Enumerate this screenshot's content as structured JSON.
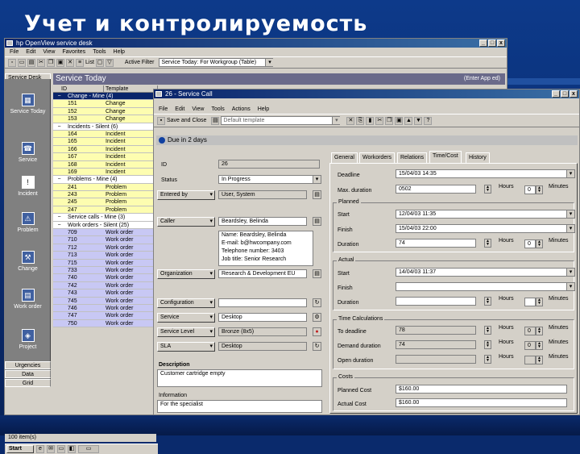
{
  "slide": {
    "title": "Учет и контролируемость"
  },
  "main_window": {
    "title": "hp OpenView service desk",
    "menu": [
      "File",
      "Edit",
      "View",
      "Favorites",
      "Tools",
      "Help"
    ],
    "toolbar": {
      "filter_label": "Active Filter",
      "view_label": "List",
      "view_value": "Service Today: For Workgroup (Table)"
    },
    "sidebar": {
      "header": "Service Desk",
      "items": [
        "Service Today",
        "Service",
        "Incident",
        "Problem",
        "Change",
        "Work order",
        "Project"
      ],
      "footer": [
        "Urgencies",
        "Data",
        "Grid"
      ]
    },
    "content_title": "Service Today",
    "content_right": "(Enter App ed)",
    "grid": {
      "columns": [
        "ID",
        "Template"
      ],
      "rows": [
        {
          "type": "sel",
          "text": "Change - Mine (4)"
        },
        {
          "type": "yel",
          "id": "151",
          "desc": "Change"
        },
        {
          "type": "yel",
          "id": "152",
          "desc": "Change"
        },
        {
          "type": "yel",
          "id": "153",
          "desc": "Change"
        },
        {
          "type": "group",
          "text": "Incidents - Silent (6)"
        },
        {
          "type": "yel",
          "id": "164",
          "desc": "Incident"
        },
        {
          "type": "yel",
          "id": "165",
          "desc": "Incident"
        },
        {
          "type": "yel",
          "id": "166",
          "desc": "Incident"
        },
        {
          "type": "yel",
          "id": "167",
          "desc": "Incident"
        },
        {
          "type": "yel",
          "id": "168",
          "desc": "Incident"
        },
        {
          "type": "yel",
          "id": "169",
          "desc": "Incident"
        },
        {
          "type": "group",
          "text": "Problems - Mine (4)"
        },
        {
          "type": "yel",
          "id": "241",
          "desc": "Problem"
        },
        {
          "type": "yel",
          "id": "243",
          "desc": "Problem"
        },
        {
          "type": "yel",
          "id": "245",
          "desc": "Problem"
        },
        {
          "type": "yel",
          "id": "247",
          "desc": "Problem"
        },
        {
          "type": "group",
          "text": "Service calls - Mine (3)"
        },
        {
          "type": "group",
          "text": "Work orders - Silent (25)"
        },
        {
          "type": "pur",
          "id": "709",
          "desc": "Work order"
        },
        {
          "type": "pur",
          "id": "710",
          "desc": "Work order"
        },
        {
          "type": "pur",
          "id": "712",
          "desc": "Work order"
        },
        {
          "type": "pur",
          "id": "713",
          "desc": "Work order"
        },
        {
          "type": "pur",
          "id": "715",
          "desc": "Work order"
        },
        {
          "type": "pur",
          "id": "733",
          "desc": "Work order"
        },
        {
          "type": "pur",
          "id": "740",
          "desc": "Work order"
        },
        {
          "type": "pur",
          "id": "742",
          "desc": "Work order"
        },
        {
          "type": "pur",
          "id": "743",
          "desc": "Work order"
        },
        {
          "type": "pur",
          "id": "745",
          "desc": "Work order"
        },
        {
          "type": "pur",
          "id": "746",
          "desc": "Work order"
        },
        {
          "type": "pur",
          "id": "747",
          "desc": "Work order"
        },
        {
          "type": "pur",
          "id": "750",
          "desc": "Work order"
        }
      ]
    },
    "status": "100 item(s)",
    "taskbar_start": "Start"
  },
  "dialog": {
    "title": "26 - Service Call",
    "menu": [
      "File",
      "Edit",
      "View",
      "Tools",
      "Actions",
      "Help"
    ],
    "save_close": "Save and Close",
    "template": "Default template",
    "banner": "Due in 2 days",
    "left": {
      "id_label": "ID",
      "id_value": "26",
      "status_label": "Status",
      "status_value": "In Progress",
      "entered_label": "Entered by",
      "entered_value": "User, System",
      "caller_label": "Caller",
      "caller_value": "Beardsley, Belinda",
      "caller_info": [
        "Name: Beardsley, Belinda",
        "E-mail: b@hwcompany.com",
        "Telephone number: 3403",
        "Job title: Senior Research"
      ],
      "org_label": "Organization",
      "org_value": "Research & Development EU",
      "config_label": "Configuration",
      "config_value": "",
      "service_label": "Service",
      "service_value": "Desktop",
      "sl_label": "Service Level",
      "sl_value": "Bronze (8x5)",
      "sla_label": "SLA",
      "sla_value": "Desktop",
      "desc_label": "Description",
      "desc_value": "Customer cartridge empty",
      "info_label": "Information",
      "info_value": "For the specialist"
    },
    "tabs": [
      "General",
      "Workorders",
      "Relations",
      "Time/Cost",
      "History"
    ],
    "active_tab": "Time/Cost",
    "right": {
      "deadline_label": "Deadline",
      "deadline_value": "15/04/03 14:35",
      "maxdur_label": "Max. duration",
      "maxdur_value": "0502",
      "hours": "Hours",
      "minutes": "Minutes",
      "zero": "0",
      "planned_title": "Planned",
      "p_start_label": "Start",
      "p_start_value": "12/04/03 11:35",
      "p_finish_label": "Finish",
      "p_finish_value": "15/04/03 22:00",
      "p_duration_label": "Duration",
      "p_duration_value": "74",
      "actual_title": "Actual",
      "a_start_label": "Start",
      "a_start_value": "14/04/03 11:37",
      "a_finish_label": "Finish",
      "a_finish_value": "",
      "a_duration_label": "Duration",
      "a_duration_value": "",
      "tc_title": "Time Calculations",
      "to_deadline_label": "To deadline",
      "to_deadline_value": "78",
      "demand_label": "Demand duration",
      "demand_value": "74",
      "open_label": "Open duration",
      "open_value": "",
      "costs_title": "Costs",
      "planned_cost_label": "Planned Cost",
      "planned_cost_value": "$160.00",
      "actual_cost_label": "Actual Cost",
      "actual_cost_value": "$160.00"
    }
  }
}
